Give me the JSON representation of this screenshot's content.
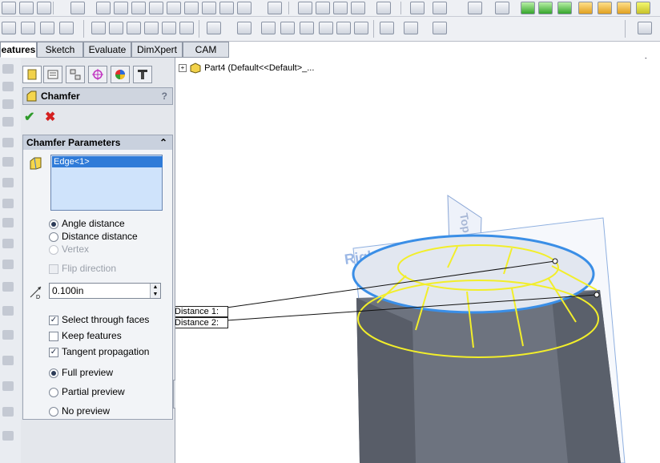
{
  "tabs": [
    {
      "label": "eatures",
      "active": true
    },
    {
      "label": "Sketch",
      "active": false
    },
    {
      "label": "Evaluate",
      "active": false
    },
    {
      "label": "DimXpert",
      "active": false
    },
    {
      "label": "CAM",
      "active": false
    }
  ],
  "tree": {
    "label": "Part4  (Default<<Default>_..."
  },
  "pm": {
    "title": "Chamfer",
    "help": "?",
    "ok": "✔",
    "cancel": "✖",
    "group": {
      "title": "Chamfer Parameters",
      "collapse": "⌃",
      "selection": "Edge<1>",
      "options": [
        {
          "label": "Angle distance",
          "checked": true,
          "disabled": false
        },
        {
          "label": "Distance distance",
          "checked": false,
          "disabled": false
        },
        {
          "label": "Vertex",
          "checked": false,
          "disabled": true
        }
      ],
      "flip": {
        "label": "Flip direction",
        "checked": false,
        "disabled": true
      },
      "distance": {
        "value": "0.100in"
      },
      "checks": [
        {
          "label": "Select through faces",
          "checked": true
        },
        {
          "label": "Keep features",
          "checked": false
        },
        {
          "label": "Tangent propagation",
          "checked": true
        }
      ],
      "preview": [
        {
          "label": "Full preview",
          "checked": true
        },
        {
          "label": "Partial preview",
          "checked": false
        },
        {
          "label": "No preview",
          "checked": false
        }
      ]
    }
  },
  "viewport": {
    "plane_label": "Right Plane",
    "top_plane_label": "Top Plane",
    "callout": [
      "Distance 1:",
      "Distance 2:"
    ]
  },
  "colors": {
    "accent_blue": "#3a8ee6",
    "preview_yellow": "#f2ee2a",
    "cylinder_dark": "#6e7480",
    "check_green": "#2e9a2a",
    "cancel_red": "#d42020"
  }
}
